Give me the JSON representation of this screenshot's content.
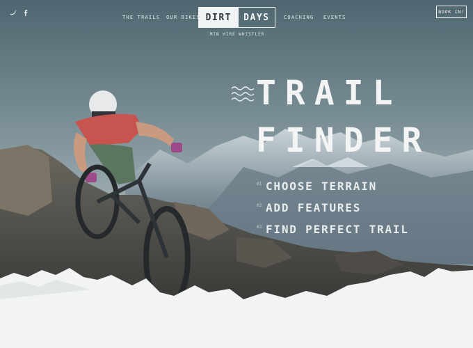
{
  "nav": {
    "social": [
      {
        "icon": "twitter-icon"
      },
      {
        "icon": "facebook-icon"
      }
    ],
    "links": [
      "THE TRAILS",
      "OUR BIKES",
      "COACHING",
      "EVENTS"
    ],
    "logo": {
      "part1": "DIRT",
      "part2": "DAYS"
    },
    "tagline": "MTB HIRE WHISTLER",
    "book_button": "BOOK IN!"
  },
  "hero": {
    "title_line1": "TRAIL",
    "title_line2": "FINDER",
    "steps": [
      {
        "num": "01",
        "label": "CHOOSE TERRAIN"
      },
      {
        "num": "02",
        "label": "ADD FEATURES"
      },
      {
        "num": "03",
        "label": "FIND PERFECT TRAIL"
      }
    ]
  },
  "colors": {
    "sky_top": "#4f6670",
    "sky_mid": "#8ea0a6",
    "text": "#f3f5f5",
    "jersey": "#c8544f"
  }
}
